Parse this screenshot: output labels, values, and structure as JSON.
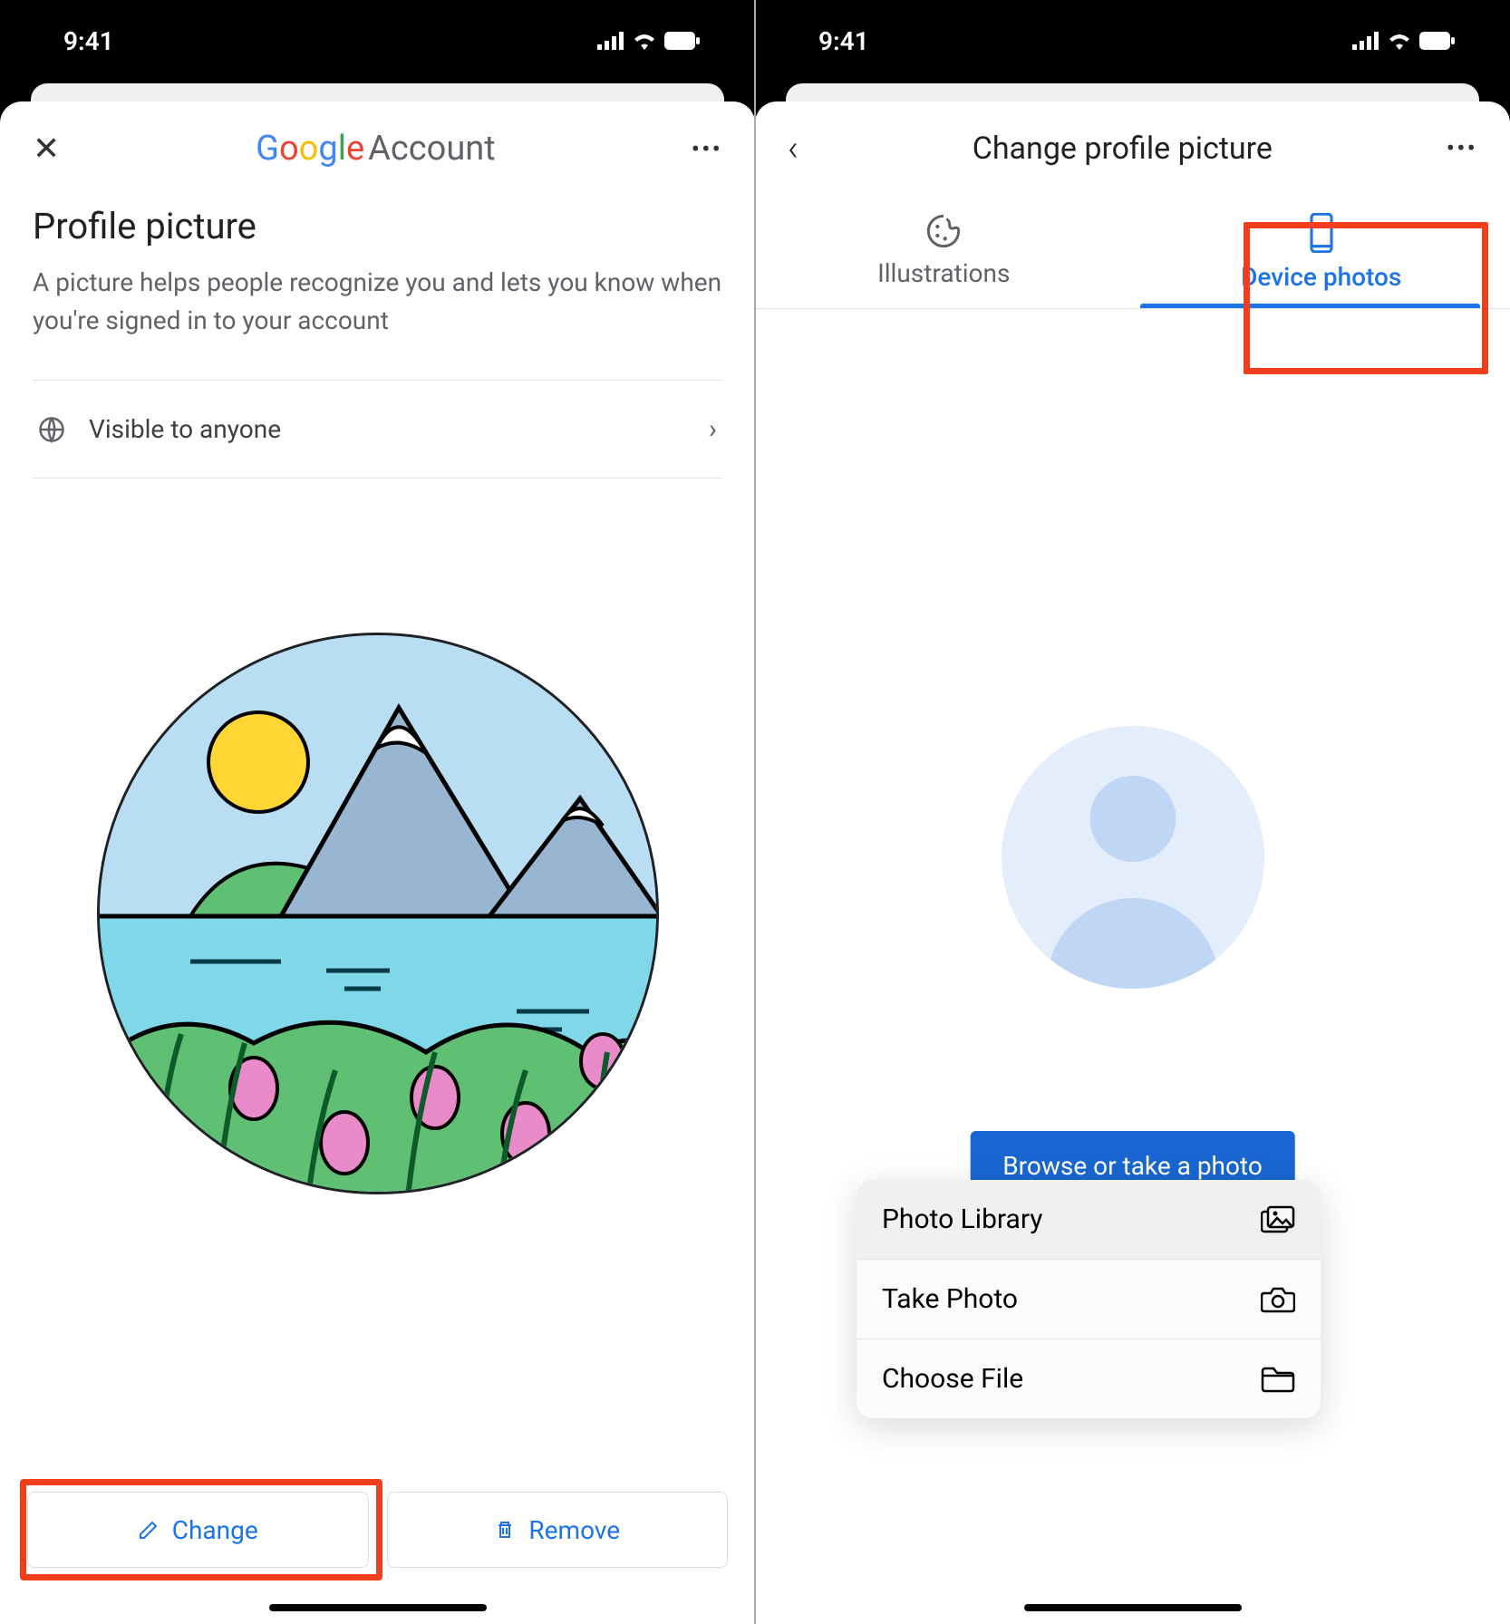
{
  "status_bar": {
    "time": "9:41"
  },
  "screen1": {
    "logo_account": "Account",
    "title": "Profile picture",
    "subtitle": "A picture helps people recognize you and lets you know when you're signed in to your account",
    "visibility_label": "Visible to anyone",
    "change_label": "Change",
    "remove_label": "Remove"
  },
  "screen2": {
    "title": "Change profile picture",
    "tab_illustrations": "Illustrations",
    "tab_device": "Device photos",
    "browse_label": "Browse or take a photo",
    "popup": {
      "photo_library": "Photo Library",
      "take_photo": "Take Photo",
      "choose_file": "Choose File"
    }
  }
}
